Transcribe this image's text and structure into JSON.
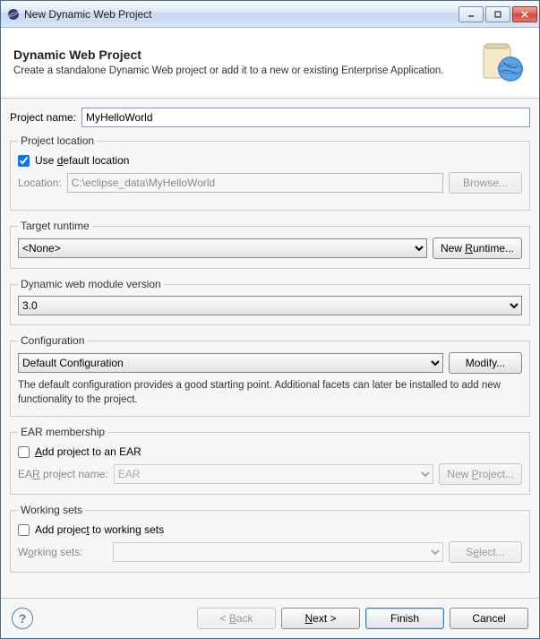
{
  "window": {
    "title": "New Dynamic Web Project"
  },
  "header": {
    "title": "Dynamic Web Project",
    "subtitle": "Create a standalone Dynamic Web project or add it to a new or existing Enterprise Application."
  },
  "project_name": {
    "label": "Project name:",
    "value": "MyHelloWorld"
  },
  "location": {
    "legend": "Project location",
    "use_default_label": "Use default location",
    "use_default_checked": true,
    "location_label": "Location:",
    "location_value": "C:\\eclipse_data\\MyHelloWorld",
    "browse_label": "Browse..."
  },
  "runtime": {
    "legend": "Target runtime",
    "selected": "<None>",
    "new_runtime_label": "New Runtime..."
  },
  "module": {
    "legend": "Dynamic web module version",
    "selected": "3.0"
  },
  "config": {
    "legend": "Configuration",
    "selected": "Default Configuration",
    "modify_label": "Modify...",
    "description": "The default configuration provides a good starting point. Additional facets can later be installed to add new functionality to the project."
  },
  "ear": {
    "legend": "EAR membership",
    "add_label": "Add project to an EAR",
    "add_checked": false,
    "name_label": "EAR project name:",
    "name_value": "EAR",
    "new_project_label": "New Project..."
  },
  "ws": {
    "legend": "Working sets",
    "add_label": "Add project to working sets",
    "add_checked": false,
    "sets_label": "Working sets:",
    "select_label": "Select..."
  },
  "footer": {
    "back": "< Back",
    "next": "Next >",
    "finish": "Finish",
    "cancel": "Cancel"
  }
}
